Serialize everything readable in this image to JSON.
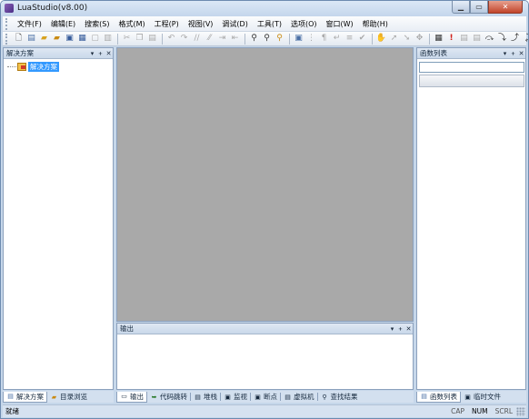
{
  "window": {
    "title": "LuaStudio(v8.00)"
  },
  "menu": [
    "文件(F)",
    "编辑(E)",
    "搜索(S)",
    "格式(M)",
    "工程(P)",
    "视图(V)",
    "调试(D)",
    "工具(T)",
    "选项(O)",
    "窗口(W)",
    "帮助(H)"
  ],
  "left_panel": {
    "title": "解决方案",
    "tree_root": "解决方案"
  },
  "right_panel": {
    "title": "函数列表"
  },
  "output_panel": {
    "title": "输出"
  },
  "left_tabs": [
    "解决方案",
    "目录浏览"
  ],
  "center_tabs": [
    "输出",
    "代码跳转",
    "堆栈",
    "监视",
    "断点",
    "虚拟机",
    "查找结果"
  ],
  "right_tabs": [
    "函数列表",
    "临时文件"
  ],
  "status": {
    "text": "就绪",
    "cap": "CAP",
    "num": "NUM",
    "scrl": "SCRL"
  },
  "panel_buttons": {
    "dropdown": "▾",
    "pin": "📌",
    "close": "✕"
  },
  "toolbar_icons": [
    "new-file",
    "new-project",
    "open-file",
    "open-project",
    "save",
    "save-all",
    "close",
    "cut",
    "copy",
    "paste",
    "undo",
    "redo",
    "comment",
    "uncomment",
    "indent",
    "outdent",
    "find",
    "find-next",
    "find-in-files",
    "bookmark",
    "indent-guide",
    "show-whitespace",
    "toggle-breakpoint",
    "format",
    "check",
    "hand",
    "run",
    "step",
    "stop",
    "debug-start",
    "breakpoint",
    "debug-a",
    "debug-b",
    "step-over",
    "step-into",
    "step-out",
    "run-to-cursor",
    "screen"
  ]
}
